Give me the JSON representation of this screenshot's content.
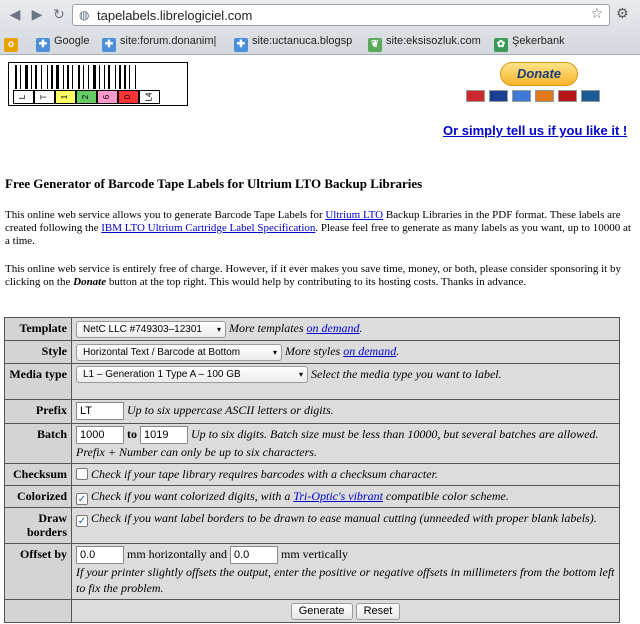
{
  "browser": {
    "url": "tapelabels.librelogiciel.com",
    "bookmarks": [
      "Google",
      "site:forum.donanim|",
      "site:uctanuca.blogsp",
      "site:eksisozluk.com",
      "Şekerbank"
    ]
  },
  "header": {
    "barcode_digits": [
      "L",
      "T",
      "1",
      "2",
      "6",
      "0",
      "L4"
    ],
    "digit_colors": [
      "#ffffff",
      "#ffffff",
      "#ffff66",
      "#66cc66",
      "#ff99cc",
      "#ff3333",
      "#ffffff"
    ],
    "donate_label": "Donate",
    "card_icons": [
      "mastercard-icon",
      "visa-icon",
      "amex-icon",
      "discover-icon",
      "bank-icon",
      "giropay-icon"
    ],
    "tell_link": "Or simply tell us if you like it !"
  },
  "intro": {
    "title": "Free Generator of Barcode Tape Labels for Ultrium LTO Backup Libraries",
    "p1_a": "This online web service allows you to generate Barcode Tape Labels for ",
    "p1_link1": "Ultrium LTO",
    "p1_b": " Backup Libraries in the PDF format. These labels are created following the ",
    "p1_link2": "IBM LTO Ultrium Cartridge Label Specification",
    "p1_c": ". Please feel free to generate as many labels as you want, up to 10000 at a time.",
    "p2_a": "This online web service is entirely free of charge. However, if it ever makes you save time, money, or both, please consider sponsoring it by clicking on the ",
    "p2_bold": "Donate",
    "p2_b": " button at the top right. This would help by contributing to its hosting costs. Thanks in advance."
  },
  "form": {
    "template": {
      "label": "Template",
      "value": "NetC LLC #749303–12301",
      "text": "More templates ",
      "link": "on demand",
      "after": "."
    },
    "style": {
      "label": "Style",
      "value": "Horizontal Text / Barcode at Bottom",
      "text": "More styles ",
      "link": "on demand",
      "after": "."
    },
    "media": {
      "label": "Media type",
      "value": "L1 – Generation 1 Type A – 100 GB",
      "text": "Select the media type you want to label."
    },
    "prefix": {
      "label": "Prefix",
      "value": "LT",
      "text": "Up to six uppercase ASCII letters or digits."
    },
    "batch": {
      "label": "Batch",
      "from": "1000",
      "to_label": "to",
      "to": "1019",
      "text": "Up to six digits. Batch size must be less than 10000, but several batches are allowed. Prefix + Number can only be up to six characters."
    },
    "checksum": {
      "label": "Checksum",
      "checked": "",
      "text": "Check if your tape library requires barcodes with a checksum character."
    },
    "colorized": {
      "label": "Colorized",
      "checked": "✓",
      "text_a": "Check if you want colorized digits, with a ",
      "link": "Tri-Optic's vibrant",
      "text_b": " compatible color scheme."
    },
    "borders": {
      "label": "Draw borders",
      "checked": "✓",
      "text": "Check if you want label borders to be drawn to ease manual cutting (unneeded with proper blank labels)."
    },
    "offset": {
      "label": "Offset by",
      "h_value": "0.0",
      "h_text": "mm horizontally and",
      "v_value": "0.0",
      "v_text": "mm vertically",
      "help": "If your printer slightly offsets the output, enter the positive or negative offsets in millimeters from the bottom left to fix the problem."
    },
    "generate_label": "Generate",
    "reset_label": "Reset"
  }
}
